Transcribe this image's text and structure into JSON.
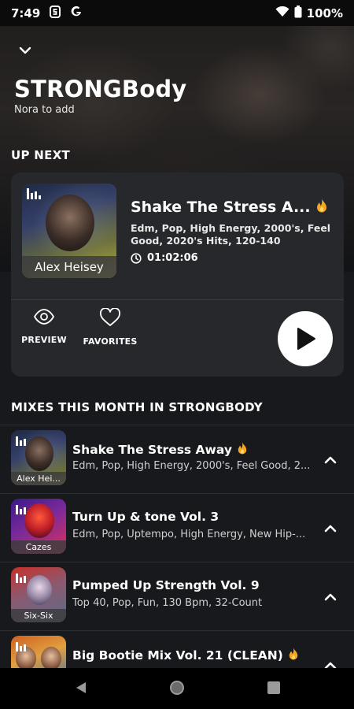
{
  "status_bar": {
    "time": "7:49",
    "icons": [
      "s-notification-icon",
      "google-icon",
      "wifi-icon",
      "battery-icon"
    ],
    "battery": "100%"
  },
  "header": {
    "title": "STRONGBody",
    "subtitle": "Nora to add"
  },
  "up_next": {
    "heading": "UP NEXT",
    "title": "Shake The Stress A...",
    "tags": "Edm, Pop, High Energy, 2000's, Feel Good, 2020's Hits, 120-140",
    "duration": "01:02:06",
    "artist": "Alex Heisey",
    "hot": true,
    "actions": {
      "preview_label": "PREVIEW",
      "favorites_label": "FAVORITES"
    }
  },
  "mixes": {
    "heading": "MIXES THIS MONTH IN STRONGBODY",
    "items": [
      {
        "title": "Shake The Stress Away",
        "tags": "Edm, Pop, High Energy, 2000's, Feel Good, 2...",
        "artist": "Alex Hei...",
        "hot": true,
        "art_colors": [
          "#1f2a44",
          "#6a6e35"
        ]
      },
      {
        "title": "Turn Up & tone Vol. 3",
        "tags": "Edm, Pop, Uptempo, High Energy, New Hip-...",
        "artist": "Cazes",
        "hot": false,
        "art_colors": [
          "#3a1a8a",
          "#e0305a"
        ]
      },
      {
        "title": "Pumped Up Strength Vol. 9",
        "tags": "Top 40, Pop, Fun, 130 Bpm, 32-Count",
        "artist": "Six-Six",
        "hot": false,
        "art_colors": [
          "#c8302a",
          "#5a6c8a"
        ]
      },
      {
        "title": "Big Bootie Mix Vol. 21 (CLEAN)",
        "tags": "",
        "artist": "",
        "hot": true,
        "art_colors": [
          "#d06020",
          "#2a6ab0"
        ]
      }
    ]
  },
  "colors": {
    "background": "#17191c",
    "card": "#26282b",
    "accent_flame": "#f5a623"
  }
}
